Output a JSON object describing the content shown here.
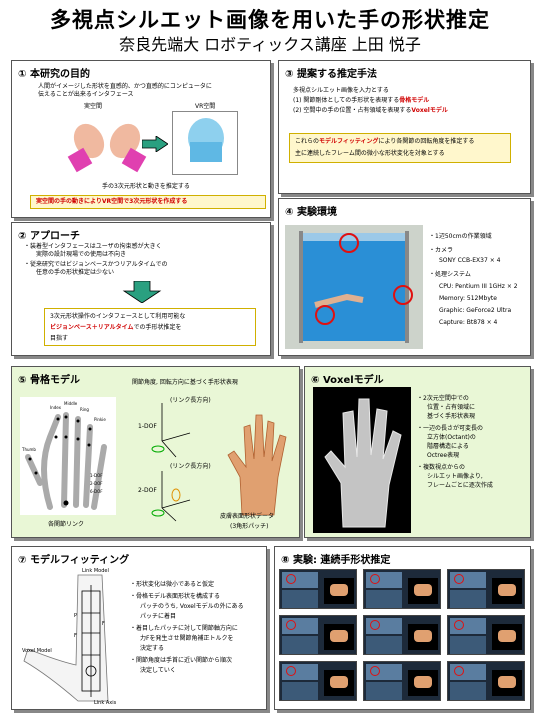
{
  "title": "多視点シルエット画像を用いた手の形状推定",
  "subtitle": "奈良先端大 ロボティックス講座 上田 悦子",
  "p1": {
    "heading": "① 本研究の目的",
    "line1": "人間がイメージした形状を直感的、かつ直感的にコンピュータに",
    "line2": "伝えることが出来るインタフェース",
    "label_real": "実空間",
    "label_vr": "VR空間",
    "caption": "手の3次元形状と動きを推定する",
    "highlight": "実空間の手の動きによりVR空間で3次元形状を作成する"
  },
  "p2": {
    "heading": "② アプローチ",
    "b1a": "装着型インタフェースはユーザの拘束感が大きく",
    "b1b": "実際の設計現場での使用は不向き",
    "b2a": "従来研究ではビジョンベースかつリアルタイムでの",
    "b2b": "任意の手の形状推定は少ない",
    "box1": "3次元形状操作のインタフェースとして利用可能な",
    "box2_red": "ビジョンベース＋リアルタイム",
    "box2_tail": "での手形状推定を",
    "box3": "目指す"
  },
  "p3": {
    "heading": "③ 提案する推定手法",
    "l1": "多視点シルエット画像を入力とする",
    "l2a": "(1) 関節剛体としての手形状を表現する",
    "l2b": "骨格モデル",
    "l3a": "(2) 空間中の手の位置・占有領域を表現する",
    "l3b": "Voxelモデル",
    "box1a": "これらの",
    "box1b": "モデルフィッティング",
    "box1c": "により各関節の回転角度を推定する",
    "box2": "主に連続したフレーム間の微小な形状変化を対象とする"
  },
  "p4": {
    "heading": "④ 実験環境",
    "items": [
      "1辺50cmの作業領域",
      "カメラ",
      "SONY CCB-EX37 × 4",
      "処理システム",
      "CPU: Pentium III 1GHz × 2",
      "Memory: 512Mbyte",
      "Graphic: GeForce2 Ultra",
      "Capture: Bt878 × 4"
    ]
  },
  "p5": {
    "heading": "⑤ 骨格モデル",
    "sub": "関節角度, 回転方向に基づく手形状表現",
    "label_link": "(リンク長方向)",
    "label_1dof": "1-DOF",
    "label_2dof": "2-DOF",
    "legend_1": "1-DOF",
    "legend_2": "2-DOF",
    "legend_6": "6-DOF",
    "finger_index": "Index",
    "finger_middle": "Middle",
    "finger_ring": "Ring",
    "finger_pinkie": "Pinkie",
    "finger_thumb": "Thumb",
    "caption_left": "各関節リンク",
    "caption_right1": "皮膚表面形状データ",
    "caption_right2": "(3角形パッチ)"
  },
  "p6": {
    "heading": "⑥ Voxelモデル",
    "b1a": "2次元空間中での",
    "b1b": "位置・占有領域に",
    "b1c": "基づく手形状表現",
    "b2a": "一辺の長さが可変長の",
    "b2b": "立方体(Octant)の",
    "b2c": "階層構造による",
    "b2d": "Octree表現",
    "b3a": "複数視点からの",
    "b3b": "シルエット画像より,",
    "b3c": "フレームごとに逐次作成"
  },
  "p7": {
    "heading": "⑦ モデルフィッティング",
    "label_link_model": "Link Model",
    "label_voxel_model": "Voxel Model",
    "label_link_axis": "Link Axis",
    "label_p": "P",
    "label_f": "F",
    "b1": "形状変化は微小であると仮定",
    "b2a": "骨格モデル表面形状を構成する",
    "b2b": "パッチのうち, Voxelモデルの外にある",
    "b2c": "パッチに着目",
    "b3a": "着目したパッチに対して関節軸方向に",
    "b3b": "力Fを発生させ関節角補正トルクを",
    "b3c": "決定する",
    "b4a": "関節角度は手首に近い関節から順次",
    "b4b": "決定していく"
  },
  "p8": {
    "heading": "⑧ 実験: 連続手形状推定"
  }
}
